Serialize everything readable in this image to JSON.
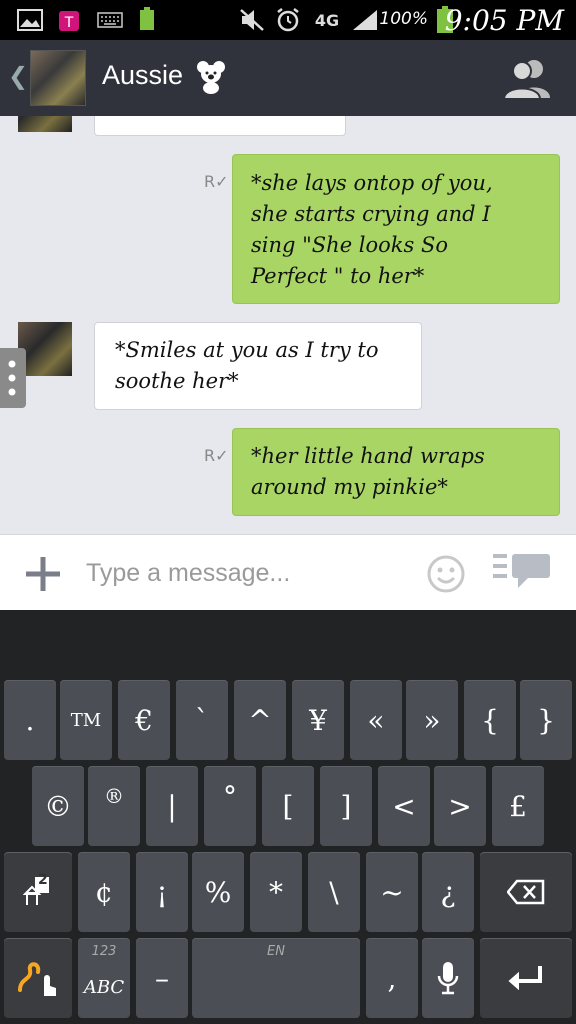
{
  "status_bar": {
    "battery_percent": "100%",
    "network": "4G",
    "time": "9:05 PM"
  },
  "header": {
    "title": "Aussie"
  },
  "messages": [
    {
      "direction": "outgoing",
      "text_lines": [
        "*she lays ontop of you,",
        "she starts crying and I",
        "sing \"She looks So",
        "Perfect \" to her*"
      ]
    },
    {
      "direction": "incoming",
      "text_lines": [
        "*Smiles at you as I try to",
        "soothe her*"
      ]
    },
    {
      "direction": "outgoing",
      "text_lines": [
        "*her little hand wraps",
        "around my pinkie*"
      ]
    }
  ],
  "composer": {
    "placeholder": "Type a message..."
  },
  "keyboard": {
    "row1": [
      ".",
      "TM",
      "€",
      "`",
      "^",
      "¥",
      "«",
      "»",
      "{",
      "}"
    ],
    "row2": [
      "©",
      "®",
      "|",
      "°",
      "[",
      "]",
      "<",
      ">",
      "£"
    ],
    "row3": [
      "¢",
      "¡",
      "%",
      "*",
      "\\",
      "~",
      "¿"
    ],
    "shift_page": "2",
    "mode_top": "123",
    "mode_bottom": "ABC",
    "dash": "–",
    "space_lang": "EN",
    "comma": ","
  }
}
